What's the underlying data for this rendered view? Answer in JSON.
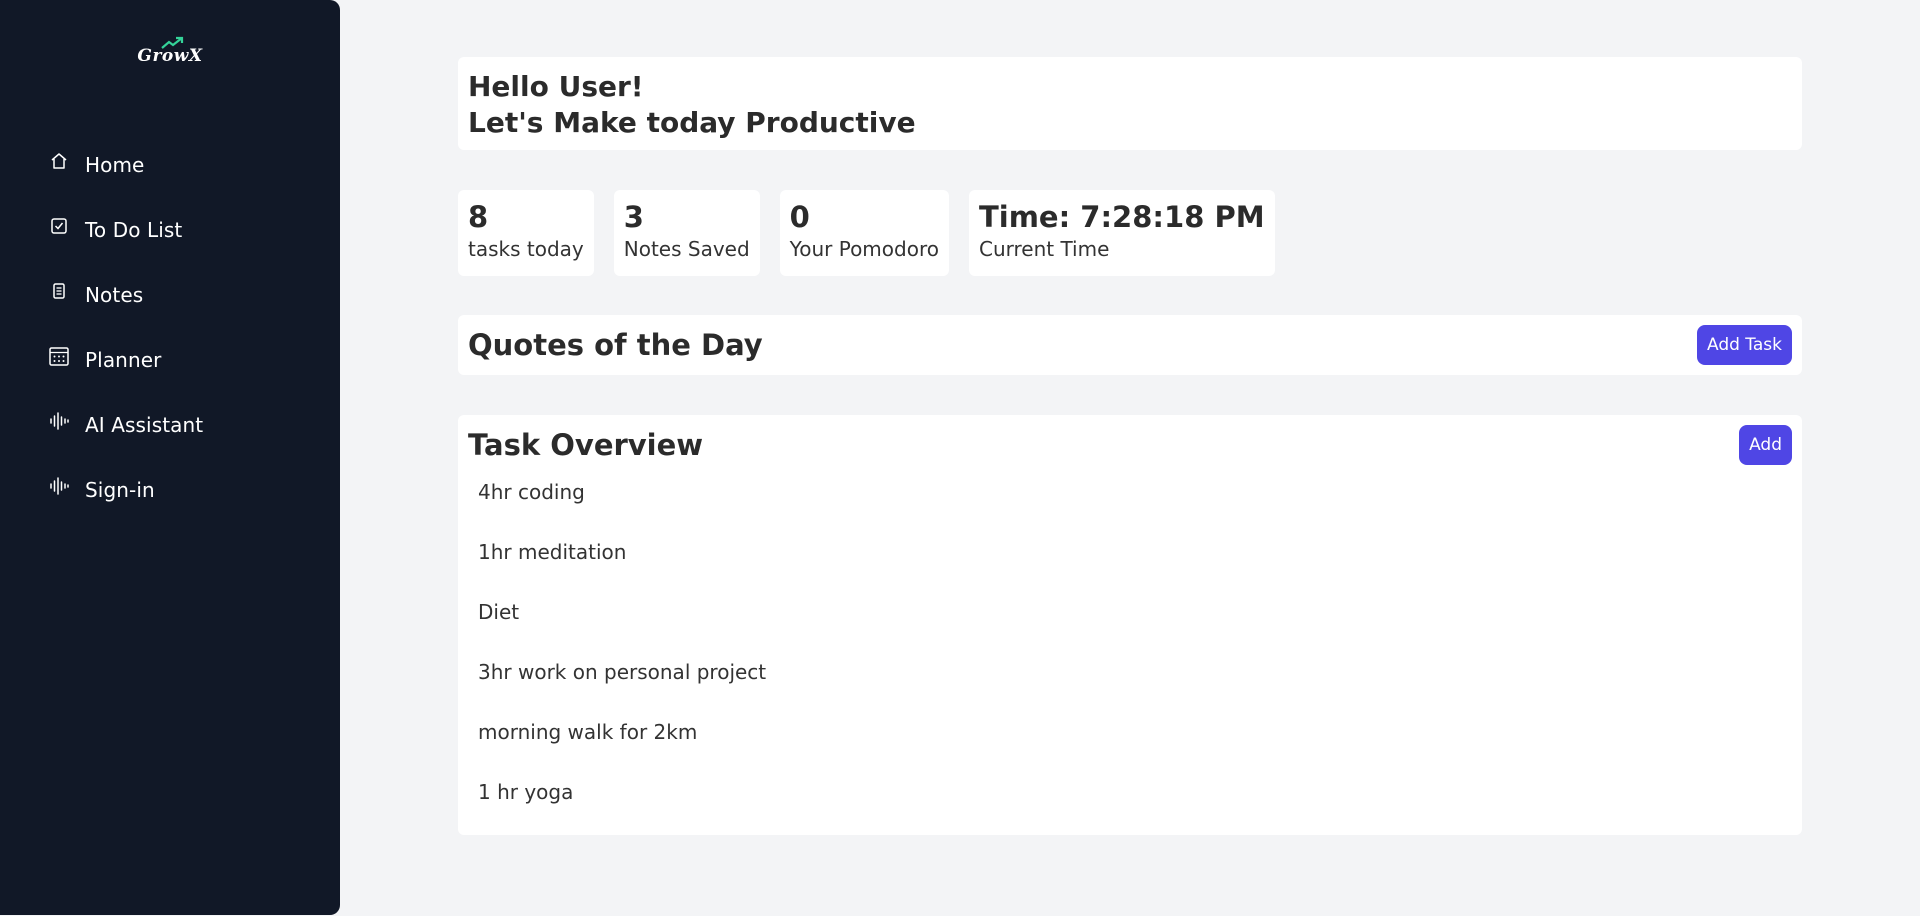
{
  "brand": {
    "name": "GrowX",
    "accent": "#34d399"
  },
  "sidebar": {
    "items": [
      {
        "label": "Home",
        "icon": "home-icon"
      },
      {
        "label": "To Do List",
        "icon": "checkbox-icon"
      },
      {
        "label": "Notes",
        "icon": "notes-icon"
      },
      {
        "label": "Planner",
        "icon": "calendar-icon"
      },
      {
        "label": "AI Assistant",
        "icon": "waveform-icon"
      },
      {
        "label": "Sign-in",
        "icon": "waveform-icon"
      }
    ]
  },
  "greeting": {
    "line1": "Hello User!",
    "line2": "Let's Make today Productive"
  },
  "stats": [
    {
      "value": "8",
      "label": "tasks today"
    },
    {
      "value": "3",
      "label": "Notes Saved"
    },
    {
      "value": "0",
      "label": "Your Pomodoro"
    },
    {
      "value": "Time: 7:28:18 PM",
      "label": "Current Time"
    }
  ],
  "quotes": {
    "title": "Quotes of the Day",
    "button": "Add Task"
  },
  "overview": {
    "title": "Task Overview",
    "button": "Add",
    "tasks": [
      "4hr coding",
      "1hr meditation",
      "Diet",
      "3hr work on personal project",
      "morning walk for 2km",
      "1 hr yoga"
    ]
  },
  "colors": {
    "sidebar_bg": "#111827",
    "page_bg": "#f3f4f6",
    "button_bg": "#4f46e5"
  }
}
